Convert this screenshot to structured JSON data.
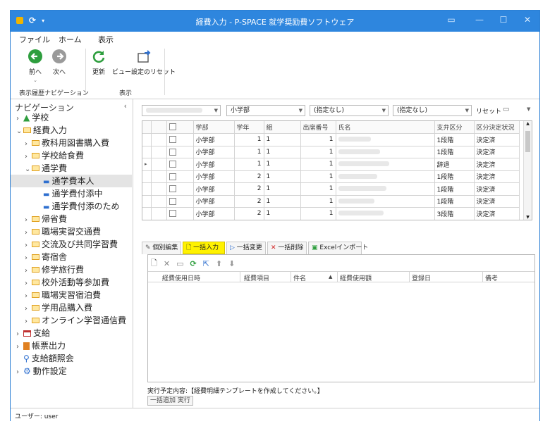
{
  "window": {
    "title": "経費入力 - P-SPACE 就学奨励費ソフトウェア"
  },
  "menu": [
    "ファイル",
    "ホーム",
    "表示"
  ],
  "ribbon": {
    "back_label": "前へ",
    "forward_label": "次へ",
    "refresh_label": "更新",
    "view_reset_label": "ビュー設定のリセット",
    "group_history": "表示履歴ナビゲーション",
    "group_view": "表示"
  },
  "navigation": {
    "header": "ナビゲーション",
    "items": [
      {
        "label": "学校",
        "icon": "school-icon",
        "level": 0,
        "arrow": "›"
      },
      {
        "label": "経費入力",
        "icon": "folder-icon",
        "level": 0,
        "arrow": "⌄"
      },
      {
        "label": "教科用図書購入費",
        "icon": "folder-icon",
        "level": 1,
        "arrow": "›"
      },
      {
        "label": "学校給食費",
        "icon": "folder-icon",
        "level": 1,
        "arrow": "›"
      },
      {
        "label": "通学費",
        "icon": "folder-icon",
        "level": 1,
        "arrow": "⌄"
      },
      {
        "label": "通学費本人",
        "icon": "bus-icon",
        "level": 2,
        "arrow": ""
      },
      {
        "label": "通学費付添中",
        "icon": "bus-icon",
        "level": 2,
        "arrow": ""
      },
      {
        "label": "通学費付添のため",
        "icon": "bus-icon",
        "level": 2,
        "arrow": ""
      },
      {
        "label": "帰省費",
        "icon": "folder-icon",
        "level": 1,
        "arrow": "›"
      },
      {
        "label": "職場実習交通費",
        "icon": "folder-icon",
        "level": 1,
        "arrow": "›"
      },
      {
        "label": "交流及び共同学習費",
        "icon": "folder-icon",
        "level": 1,
        "arrow": "›"
      },
      {
        "label": "寄宿舎",
        "icon": "folder-icon",
        "level": 1,
        "arrow": "›"
      },
      {
        "label": "修学旅行費",
        "icon": "folder-icon",
        "level": 1,
        "arrow": "›"
      },
      {
        "label": "校外活動等参加費",
        "icon": "folder-icon",
        "level": 1,
        "arrow": "›"
      },
      {
        "label": "職場実習宿泊費",
        "icon": "folder-icon",
        "level": 1,
        "arrow": "›"
      },
      {
        "label": "学用品購入費",
        "icon": "folder-icon",
        "level": 1,
        "arrow": "›"
      },
      {
        "label": "オンライン学習通信費",
        "icon": "folder-icon",
        "level": 1,
        "arrow": "›"
      },
      {
        "label": "支給",
        "icon": "calendar-icon",
        "level": 0,
        "arrow": "›"
      },
      {
        "label": "帳票出力",
        "icon": "report-icon",
        "level": 0,
        "arrow": "›"
      },
      {
        "label": "支給額照会",
        "icon": "search-icon",
        "level": 0,
        "arrow": ""
      },
      {
        "label": "動作設定",
        "icon": "gear-icon",
        "level": 0,
        "arrow": "›"
      }
    ],
    "selected_index": 5
  },
  "filters": {
    "dept": "小学部",
    "f2": "(指定なし)",
    "f3": "(指定なし)",
    "reset": "リセット"
  },
  "grid": {
    "columns": [
      "学部",
      "学年",
      "組",
      "出席番号",
      "氏名",
      "支弁区分",
      "区分決定状況"
    ],
    "rows": [
      [
        "小学部",
        "1",
        "1",
        "1",
        "",
        "1段階",
        "決定済"
      ],
      [
        "小学部",
        "1",
        "1",
        "1",
        "",
        "1段階",
        "決定済"
      ],
      [
        "小学部",
        "1",
        "1",
        "1",
        "",
        "辞退",
        "決定済"
      ],
      [
        "小学部",
        "2",
        "1",
        "1",
        "",
        "1段階",
        "決定済"
      ],
      [
        "小学部",
        "2",
        "1",
        "1",
        "",
        "1段階",
        "決定済"
      ],
      [
        "小学部",
        "2",
        "1",
        "1",
        "",
        "1段階",
        "決定済"
      ],
      [
        "小学部",
        "2",
        "1",
        "1",
        "",
        "3段階",
        "決定済"
      ]
    ],
    "current_row": 2
  },
  "tabs": [
    "個別編集",
    "一括入力",
    "一括変更",
    "一括削除",
    "Excelインポート"
  ],
  "detail": {
    "columns": [
      "経費使用日時",
      "経費項目",
      "件名",
      "経費使用額",
      "登録日",
      "備考"
    ],
    "exec_text": "実行予定内容:【経費明細テンプレートを作成してください。】",
    "exec_button": "一括追加 実行"
  },
  "status": {
    "user": "ユーザー: user"
  },
  "colors": {
    "titlebar": "#2e86de",
    "highlight": "#fff200",
    "refresh_green": "#2e9e3e"
  }
}
